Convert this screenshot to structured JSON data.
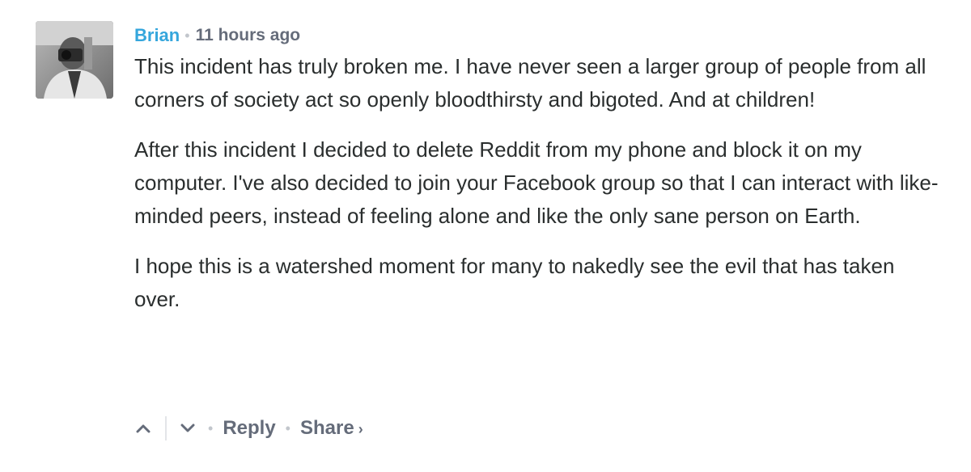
{
  "comment": {
    "author": "Brian",
    "separator": "•",
    "timestamp": "11 hours ago",
    "paragraphs": [
      "This incident has truly broken me. I have never seen a larger group of people from all corners of society act so openly bloodthirsty and bigoted. And at children!",
      "After this incident I decided to delete Reddit from my phone and block it on my computer. I've also decided to join your Facebook group so that I can interact with like-minded peers, instead of feeling alone and like the only sane person on Earth.",
      "I hope this is a watershed moment for many to nakedly see the evil that has taken over."
    ]
  },
  "actions": {
    "upvote_icon": "chevron-up-icon",
    "downvote_icon": "chevron-down-icon",
    "separator": "•",
    "reply_label": "Reply",
    "share_label": "Share",
    "share_chevron": "›"
  },
  "colors": {
    "author": "#35a6dc",
    "meta": "#656c7a",
    "text": "#2a2e2e",
    "separator": "#c2c6cc"
  }
}
